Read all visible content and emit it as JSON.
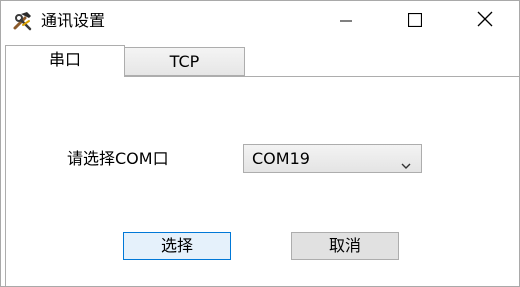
{
  "window": {
    "title": "通讯设置",
    "icon": "tools-icon",
    "controls": [
      "minimize-icon",
      "maximize-icon",
      "close-icon"
    ]
  },
  "tabs": [
    {
      "label": "串口",
      "active": true
    },
    {
      "label": "TCP",
      "active": false
    }
  ],
  "form": {
    "port_label": "请选择COM口",
    "port_selected": "COM19"
  },
  "buttons": {
    "select_label": "选择",
    "cancel_label": "取消"
  }
}
